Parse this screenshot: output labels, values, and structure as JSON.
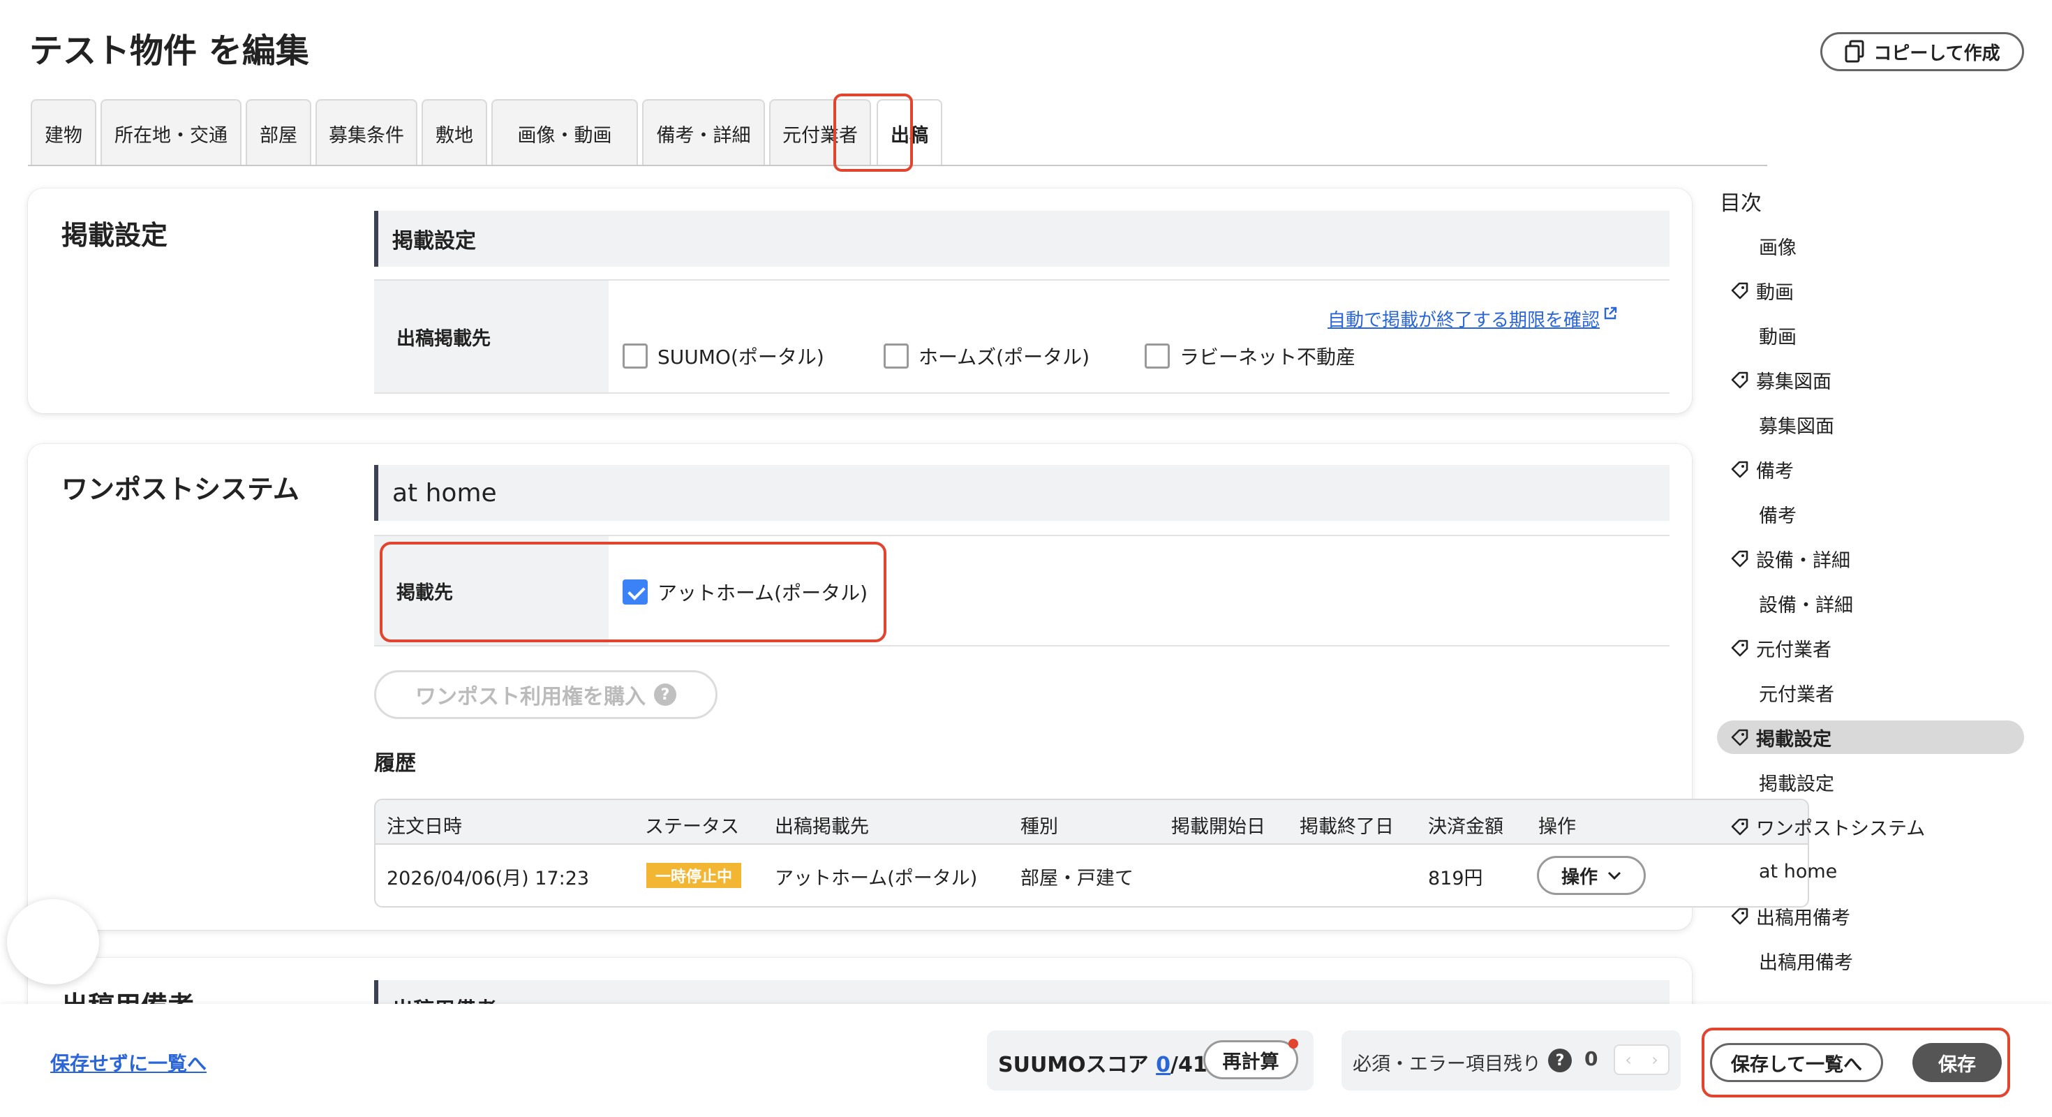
{
  "header": {
    "title": "テスト物件 を編集",
    "copy_button": "コピーして作成"
  },
  "tabs": [
    {
      "label": "建物"
    },
    {
      "label": "所在地・交通"
    },
    {
      "label": "部屋"
    },
    {
      "label": "募集条件"
    },
    {
      "label": "敷地"
    },
    {
      "label": "画像・動画"
    },
    {
      "label": "備考・詳細"
    },
    {
      "label": "元付業者"
    },
    {
      "label": "出稿",
      "active": true
    }
  ],
  "listing_settings": {
    "title": "掲載設定",
    "section_header": "掲載設定",
    "row_label": "出稿掲載先",
    "expiry_link": "自動で掲載が終了する期限を確認",
    "options": [
      {
        "label": "SUUMO(ポータル)",
        "checked": false
      },
      {
        "label": "ホームズ(ポータル)",
        "checked": false
      },
      {
        "label": "ラビーネット不動産",
        "checked": false
      }
    ]
  },
  "onepost": {
    "title": "ワンポストシステム",
    "section_header": "at home",
    "row_label": "掲載先",
    "option": {
      "label": "アットホーム(ポータル)",
      "checked": true
    },
    "purchase_button": "ワンポスト利用権を購入",
    "history_title": "履歴",
    "history_columns": [
      "注文日時",
      "ステータス",
      "出稿掲載先",
      "種別",
      "掲載開始日",
      "掲載終了日",
      "決済金額",
      "操作"
    ],
    "history_rows": [
      {
        "ordered_at": "2026/04/06(月) 17:23",
        "status": "一時停止中",
        "destination": "アットホーム(ポータル)",
        "type": "部屋・戸建て",
        "start": "",
        "end": "",
        "amount": "819円",
        "action": "操作"
      }
    ]
  },
  "remarks_section": {
    "title": "出稿用備考",
    "section_header": "出稿用備考"
  },
  "toc": {
    "heading": "目次",
    "items": [
      {
        "label": "画像",
        "level": 2
      },
      {
        "label": "動画",
        "level": 1
      },
      {
        "label": "動画",
        "level": 2
      },
      {
        "label": "募集図面",
        "level": 1
      },
      {
        "label": "募集図面",
        "level": 2
      },
      {
        "label": "備考",
        "level": 1
      },
      {
        "label": "備考",
        "level": 2
      },
      {
        "label": "設備・詳細",
        "level": 1
      },
      {
        "label": "設備・詳細",
        "level": 2
      },
      {
        "label": "元付業者",
        "level": 1
      },
      {
        "label": "元付業者",
        "level": 2
      },
      {
        "label": "掲載設定",
        "level": 1,
        "active": true
      },
      {
        "label": "掲載設定",
        "level": 2
      },
      {
        "label": "ワンポストシステム",
        "level": 1
      },
      {
        "label": "at home",
        "level": 2
      },
      {
        "label": "出稿用備考",
        "level": 1
      },
      {
        "label": "出稿用備考",
        "level": 2
      }
    ]
  },
  "footer": {
    "back_link": "保存せずに一覧へ",
    "score_label": "SUUMOスコア",
    "score_current": "0",
    "score_total": "/41",
    "recalc_button": "再計算",
    "remaining_label": "必須・エラー項目残り",
    "remaining_help": "?",
    "remaining_count": "0",
    "save_and_list_button": "保存して一覧へ",
    "save_button": "保存"
  },
  "colors": {
    "accent_highlight": "#e2452f",
    "link": "#2b66d9",
    "status_badge": "#f2b632",
    "checkbox_checked": "#3b82f6"
  }
}
